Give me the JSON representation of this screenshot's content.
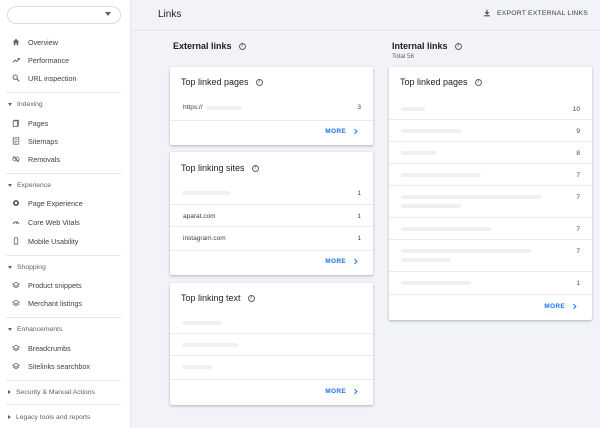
{
  "page": {
    "title": "Links",
    "export_label": "EXPORT EXTERNAL LINKS"
  },
  "sidebar": {
    "property_value": "",
    "items_top": [
      {
        "label": "Overview",
        "icon": "home-icon"
      },
      {
        "label": "Performance",
        "icon": "trending-up-icon"
      },
      {
        "label": "URL inspection",
        "icon": "search-icon"
      }
    ],
    "sections": {
      "indexing": {
        "label": "Indexing",
        "items": [
          {
            "label": "Pages",
            "icon": "pages-icon"
          },
          {
            "label": "Sitemaps",
            "icon": "sitemap-icon"
          },
          {
            "label": "Removals",
            "icon": "eye-off-icon"
          }
        ]
      },
      "experience": {
        "label": "Experience",
        "items": [
          {
            "label": "Page Experience",
            "icon": "badge-icon"
          },
          {
            "label": "Core Web Vitals",
            "icon": "gauge-icon"
          },
          {
            "label": "Mobile Usability",
            "icon": "phone-icon"
          }
        ]
      },
      "shopping": {
        "label": "Shopping",
        "items": [
          {
            "label": "Product snippets",
            "icon": "layers-icon"
          },
          {
            "label": "Merchant listings",
            "icon": "layers-icon"
          }
        ]
      },
      "enhancements": {
        "label": "Enhancements",
        "items": [
          {
            "label": "Breadcrumbs",
            "icon": "layers-icon"
          },
          {
            "label": "Sitelinks searchbox",
            "icon": "layers-icon"
          }
        ]
      },
      "security": {
        "label": "Security & Manual Actions"
      },
      "legacy": {
        "label": "Legacy tools and reports"
      }
    }
  },
  "external": {
    "title": "External links",
    "top_linked_pages": {
      "title": "Top linked pages",
      "rows": [
        {
          "label": "https://",
          "value": "3"
        }
      ],
      "more": "MORE"
    },
    "top_linking_sites": {
      "title": "Top linking sites",
      "rows": [
        {
          "label": "",
          "value": "1"
        },
        {
          "label": "aparat.com",
          "value": "1"
        },
        {
          "label": "instagram.com",
          "value": "1"
        }
      ],
      "more": "MORE"
    },
    "top_linking_text": {
      "title": "Top linking text",
      "rows": [
        {
          "label": ""
        },
        {
          "label": ""
        },
        {
          "label": ""
        }
      ],
      "more": "MORE"
    }
  },
  "internal": {
    "title": "Internal links",
    "subtitle": "Total 56",
    "top_linked_pages": {
      "title": "Top linked pages",
      "rows": [
        {
          "value": "10"
        },
        {
          "value": "9"
        },
        {
          "value": "8"
        },
        {
          "value": "7"
        },
        {
          "value": "7"
        },
        {
          "value": "7"
        },
        {
          "value": "7"
        },
        {
          "value": "1"
        }
      ],
      "more": "MORE"
    }
  }
}
